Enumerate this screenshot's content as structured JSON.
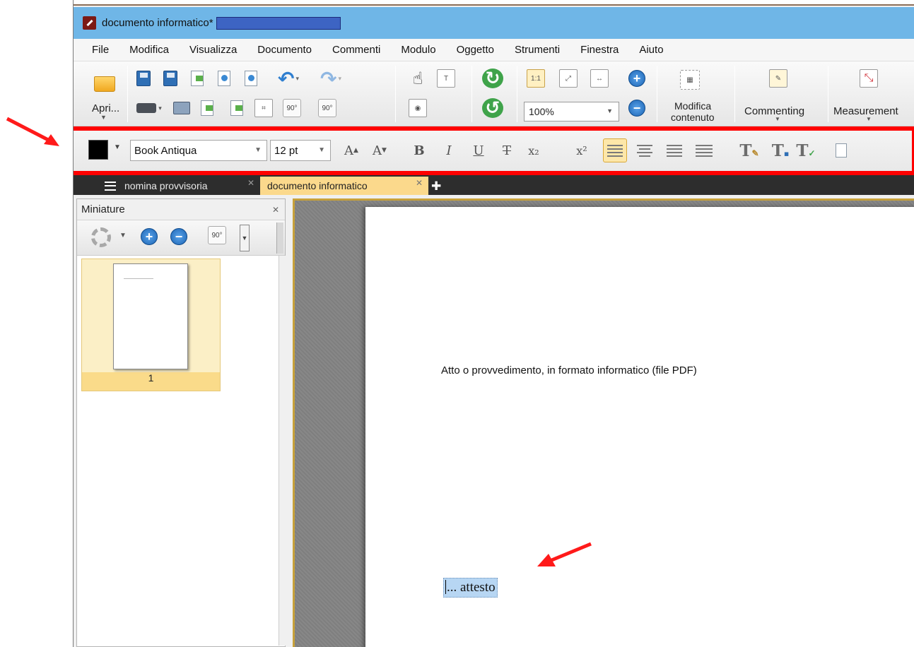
{
  "window": {
    "title": "documento informatico*",
    "title_redacted": true
  },
  "menu": [
    "File",
    "Modifica",
    "Visualizza",
    "Documento",
    "Commenti",
    "Modulo",
    "Oggetto",
    "Strumenti",
    "Finestra",
    "Aiuto"
  ],
  "ribbon": {
    "open_label": "Apri...",
    "zoom_value": "100%",
    "rotate_label": "90°",
    "actual_size_label": "1:1",
    "edit_content_label_line1": "Modifica",
    "edit_content_label_line2": "contenuto",
    "commenting_label": "Commenting",
    "measurement_label": "Measurement"
  },
  "format_toolbar": {
    "text_color": "#000000",
    "font_family": "Book Antiqua",
    "font_size": "12 pt",
    "buttons": {
      "grow_font": "A",
      "shrink_font": "A",
      "bold": "B",
      "italic": "I",
      "underline": "U",
      "strikethrough": "T",
      "subscript": "x₂",
      "superscript": "x²"
    },
    "active_alignment": "left"
  },
  "tabs": [
    {
      "label": "nomina provvisoria",
      "active": false
    },
    {
      "label": "documento informatico",
      "active": true
    }
  ],
  "thumbnails_panel": {
    "title": "Miniature",
    "rotate_label": "90°",
    "pages": [
      {
        "number": "1",
        "selected": true
      }
    ]
  },
  "document": {
    "line1": "Atto o provvedimento, in formato informatico (file PDF)",
    "selected_text": "... attesto",
    "selected_word": "attesto"
  },
  "colors": {
    "titlebar": "#6fb6e7",
    "highlight_frame": "#ff0000",
    "active_tab": "#fbd98c",
    "selection": "#b7d6f3"
  }
}
